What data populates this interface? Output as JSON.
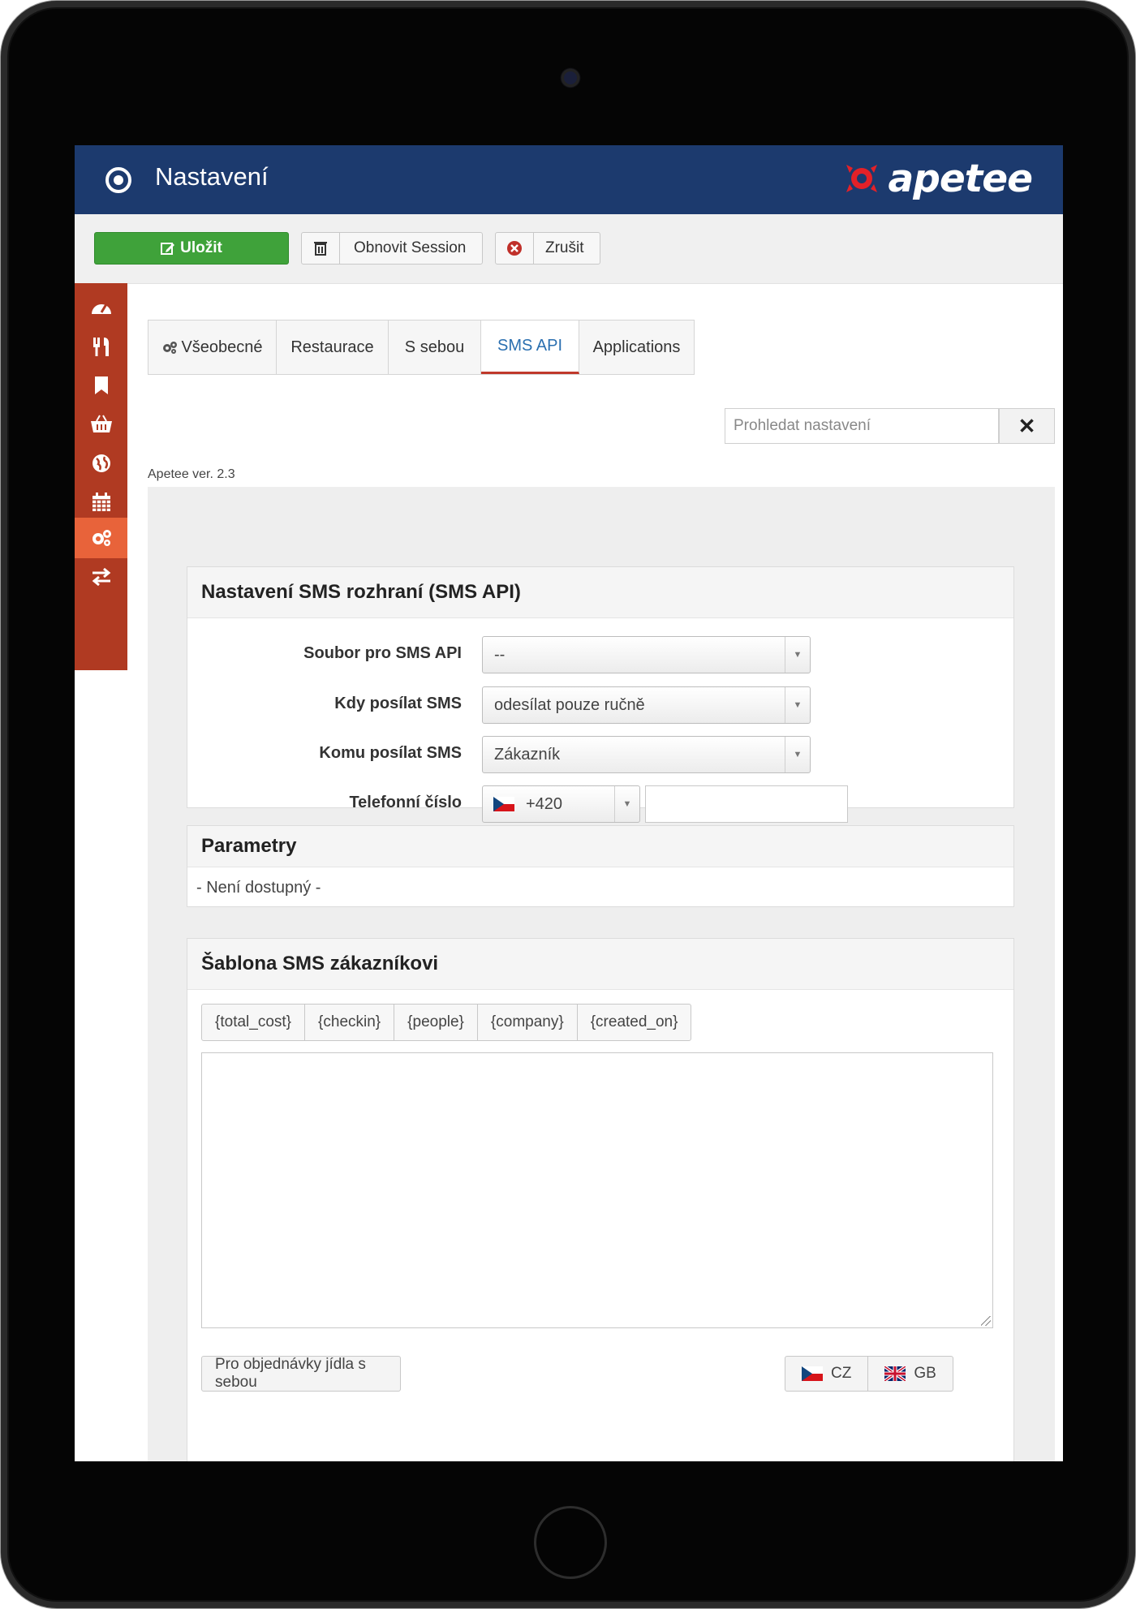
{
  "header": {
    "title": "Nastavení",
    "logo_text": "apetee"
  },
  "toolbar": {
    "save_label": "Uložit",
    "session_label": "Obnovit Session",
    "cancel_label": "Zrušit"
  },
  "tabs": [
    {
      "label": "Všeobecné",
      "active": false
    },
    {
      "label": "Restaurace",
      "active": false
    },
    {
      "label": "S sebou",
      "active": false
    },
    {
      "label": "SMS API",
      "active": true
    },
    {
      "label": "Applications",
      "active": false
    }
  ],
  "search": {
    "placeholder": "Prohledat nastavení"
  },
  "version": "Apetee ver. 2.3",
  "sms_panel": {
    "title": "Nastavení SMS rozhraní (SMS API)",
    "fields": [
      {
        "label": "Soubor pro SMS API",
        "value": "--"
      },
      {
        "label": "Kdy posílat SMS",
        "value": "odesílat pouze ručně"
      },
      {
        "label": "Komu posílat SMS",
        "value": "Zákazník"
      }
    ],
    "phone": {
      "label": "Telefonní číslo",
      "prefix": "+420",
      "value": ""
    }
  },
  "params_panel": {
    "title": "Parametry",
    "note": "- Není dostupný -"
  },
  "template_panel": {
    "title": "Šablona SMS zákazníkovi",
    "placeholders": [
      "{total_cost}",
      "{checkin}",
      "{people}",
      "{company}",
      "{created_on}"
    ],
    "text": "",
    "takeaway_button": "Pro objednávky jídla s sebou",
    "languages": [
      "CZ",
      "GB"
    ]
  },
  "colors": {
    "header": "#1c3a6e",
    "sidebar": "#b03a22",
    "sidebar_active": "#e8633a",
    "save": "#3fa23a",
    "active_tab": "#2a6fb0"
  }
}
